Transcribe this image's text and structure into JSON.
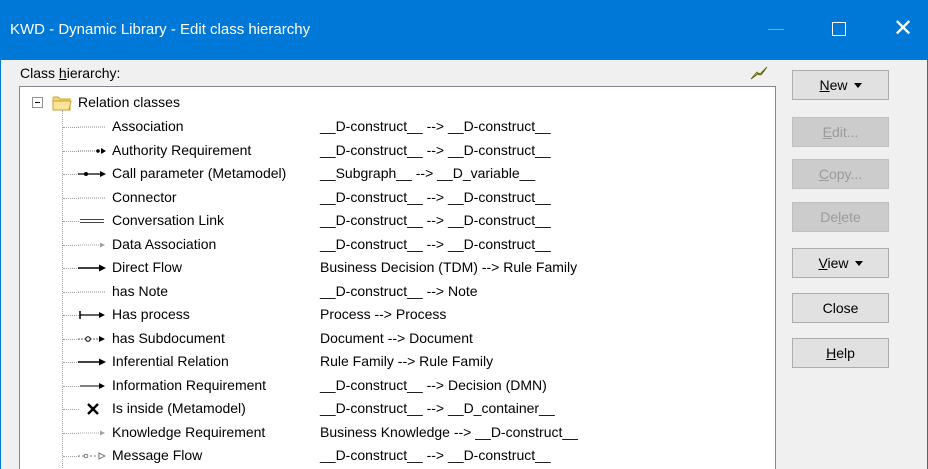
{
  "window": {
    "title": "KWD - Dynamic Library - Edit class hierarchy",
    "close_glyph": "✕"
  },
  "tree": {
    "label_before": "Class ",
    "label_mnemonic": "h",
    "label_after": "ierarchy:",
    "root_label": "Relation classes",
    "items": [
      {
        "name": "Association",
        "relation": "__D-construct__ --> __D-construct__",
        "icon": "dotted-line-icon"
      },
      {
        "name": "Authority Requirement",
        "relation": "__D-construct__ --> __D-construct__",
        "icon": "dotted-dot-arrow-icon"
      },
      {
        "name": "Call parameter (Metamodel)",
        "relation": "__Subgraph__ --> __D_variable__",
        "icon": "dot-arrow-icon"
      },
      {
        "name": "Connector",
        "relation": "__D-construct__ --> __D-construct__",
        "icon": "dotted-line-icon"
      },
      {
        "name": "Conversation Link",
        "relation": "__D-construct__ --> __D-construct__",
        "icon": "double-line-icon"
      },
      {
        "name": "Data Association",
        "relation": "__D-construct__ --> __D-construct__",
        "icon": "dotted-arrow-icon"
      },
      {
        "name": "Direct Flow",
        "relation": "Business Decision (TDM) --> Rule Family",
        "icon": "solid-arrow-icon"
      },
      {
        "name": "has Note",
        "relation": "__D-construct__ --> Note",
        "icon": "dotted-line-icon"
      },
      {
        "name": "Has process",
        "relation": "Process --> Process",
        "icon": "bar-arrow-icon"
      },
      {
        "name": "has Subdocument",
        "relation": "Document --> Document",
        "icon": "circle-arrow-icon"
      },
      {
        "name": "Inferential Relation",
        "relation": "Rule Family --> Rule Family",
        "icon": "solid-arrow-icon"
      },
      {
        "name": "Information Requirement",
        "relation": "__D-construct__ --> Decision (DMN)",
        "icon": "thin-arrow-icon"
      },
      {
        "name": "Is inside (Metamodel)",
        "relation": "__D-construct__ --> __D_container__",
        "icon": "cross-icon"
      },
      {
        "name": "Knowledge Requirement",
        "relation": "Business Knowledge --> __D-construct__",
        "icon": "dotted-arrow-icon"
      },
      {
        "name": "Message Flow",
        "relation": "__D-construct__ --> __D-construct__",
        "icon": "dashed-open-arrow-icon"
      }
    ]
  },
  "buttons": {
    "new": {
      "mnemonic": "N",
      "rest": "ew"
    },
    "edit": {
      "mnemonic": "E",
      "rest": "dit..."
    },
    "copy": {
      "mnemonic": "C",
      "rest": "opy..."
    },
    "delete": {
      "before": "De",
      "mnemonic": "l",
      "rest": "ete"
    },
    "view": {
      "mnemonic": "V",
      "rest": "iew"
    },
    "close": {
      "label": "Close"
    },
    "help": {
      "mnemonic": "H",
      "rest": "elp"
    }
  },
  "colors": {
    "titlebar": "#0078d7",
    "folder": "#f8d775",
    "bolt": "#c8c800"
  }
}
